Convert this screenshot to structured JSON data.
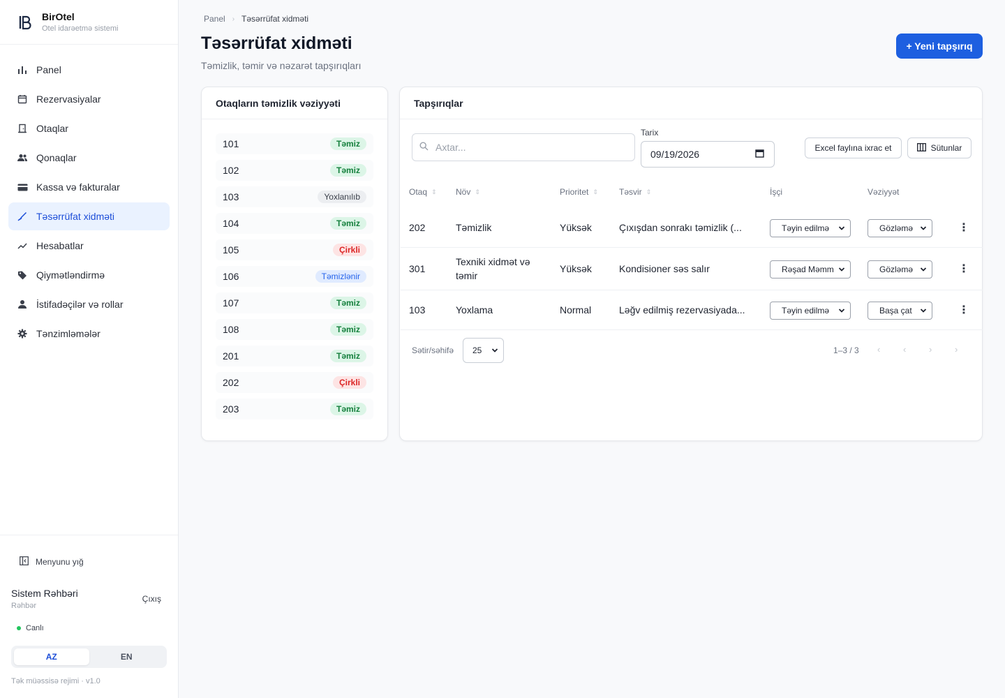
{
  "brand": {
    "name": "BirOtel",
    "subtitle": "Otel idarəetmə sistemi"
  },
  "nav": [
    {
      "label": "Panel",
      "icon": "bar-chart-icon",
      "active": false
    },
    {
      "label": "Rezervasiyalar",
      "icon": "calendar-icon",
      "active": false
    },
    {
      "label": "Otaqlar",
      "icon": "door-icon",
      "active": false
    },
    {
      "label": "Qonaqlar",
      "icon": "people-icon",
      "active": false
    },
    {
      "label": "Kassa və fakturalar",
      "icon": "wallet-icon",
      "active": false
    },
    {
      "label": "Təsərrüfat xidməti",
      "icon": "broom-icon",
      "active": true
    },
    {
      "label": "Hesabatlar",
      "icon": "trend-icon",
      "active": false
    },
    {
      "label": "Qiymətləndirmə",
      "icon": "tag-icon",
      "active": false
    },
    {
      "label": "İstifadəçilər və rollar",
      "icon": "user-icon",
      "active": false
    },
    {
      "label": "Tənzimləmələr",
      "icon": "gear-icon",
      "active": false
    }
  ],
  "sidebar_bottom": {
    "collapse_label": "Menyunu yığ",
    "user_name": "Sistem Rəhbəri",
    "user_role": "Rəhbər",
    "logout_label": "Çıxış",
    "status_label": "Canlı",
    "lang_az": "AZ",
    "lang_en": "EN",
    "active_lang": "AZ",
    "version": "Tək müəssisə rejimi · v1.0"
  },
  "breadcrumb": {
    "root": "Panel",
    "current": "Təsərrüfat xidməti"
  },
  "page": {
    "title": "Təsərrüfat xidməti",
    "subtitle": "Təmizlik, təmir və nəzarət tapşırıqları",
    "new_button": "+ Yeni tapşırıq"
  },
  "rooms_card": {
    "title": "Otaqların təmizlik vəziyyəti",
    "rooms": [
      {
        "number": "101",
        "status": "Təmiz",
        "kind": "clean"
      },
      {
        "number": "102",
        "status": "Təmiz",
        "kind": "clean"
      },
      {
        "number": "103",
        "status": "Yoxlanılıb",
        "kind": "check"
      },
      {
        "number": "104",
        "status": "Təmiz",
        "kind": "clean"
      },
      {
        "number": "105",
        "status": "Çirkli",
        "kind": "dirty"
      },
      {
        "number": "106",
        "status": "Təmizlənir",
        "kind": "cleaning"
      },
      {
        "number": "107",
        "status": "Təmiz",
        "kind": "clean"
      },
      {
        "number": "108",
        "status": "Təmiz",
        "kind": "clean"
      },
      {
        "number": "201",
        "status": "Təmiz",
        "kind": "clean"
      },
      {
        "number": "202",
        "status": "Çirkli",
        "kind": "dirty"
      },
      {
        "number": "203",
        "status": "Təmiz",
        "kind": "clean"
      }
    ]
  },
  "tasks_card": {
    "title": "Tapşırıqlar",
    "search_placeholder": "Axtar...",
    "date_label": "Tarix",
    "date_value": "09/19/2026",
    "export_label": "Excel faylına ixrac et",
    "columns_label": "Sütunlar",
    "headers": {
      "room": "Otaq",
      "type": "Növ",
      "priority": "Prioritet",
      "description": "Təsvir",
      "worker": "İşçi",
      "status": "Vəziyyət"
    },
    "rows": [
      {
        "room": "202",
        "type": "Təmizlik",
        "type2": "",
        "priority": "Yüksək",
        "description": "Çıxışdan sonrakı təmizlik (...",
        "worker": "Təyin edilmə",
        "status": "Gözləmə"
      },
      {
        "room": "301",
        "type": "Texniki xidmət və",
        "type2": "təmir",
        "priority": "Yüksək",
        "description": "Kondisioner səs salır",
        "worker": "Rəşad Məmm",
        "status": "Gözləmə"
      },
      {
        "room": "103",
        "type": "Yoxlama",
        "type2": "",
        "priority": "Normal",
        "description": "Ləğv edilmiş rezervasiyada...",
        "worker": "Təyin edilmə",
        "status": "Başa çat"
      }
    ],
    "pager": {
      "rows_label": "Sətir/səhifə",
      "rows_value": "25",
      "info": "1–3 / 3"
    }
  },
  "colors": {
    "accent": "#1d5fe0",
    "active_nav_bg": "#eaf2ff",
    "clean": "#15803d",
    "dirty": "#dc2626"
  }
}
